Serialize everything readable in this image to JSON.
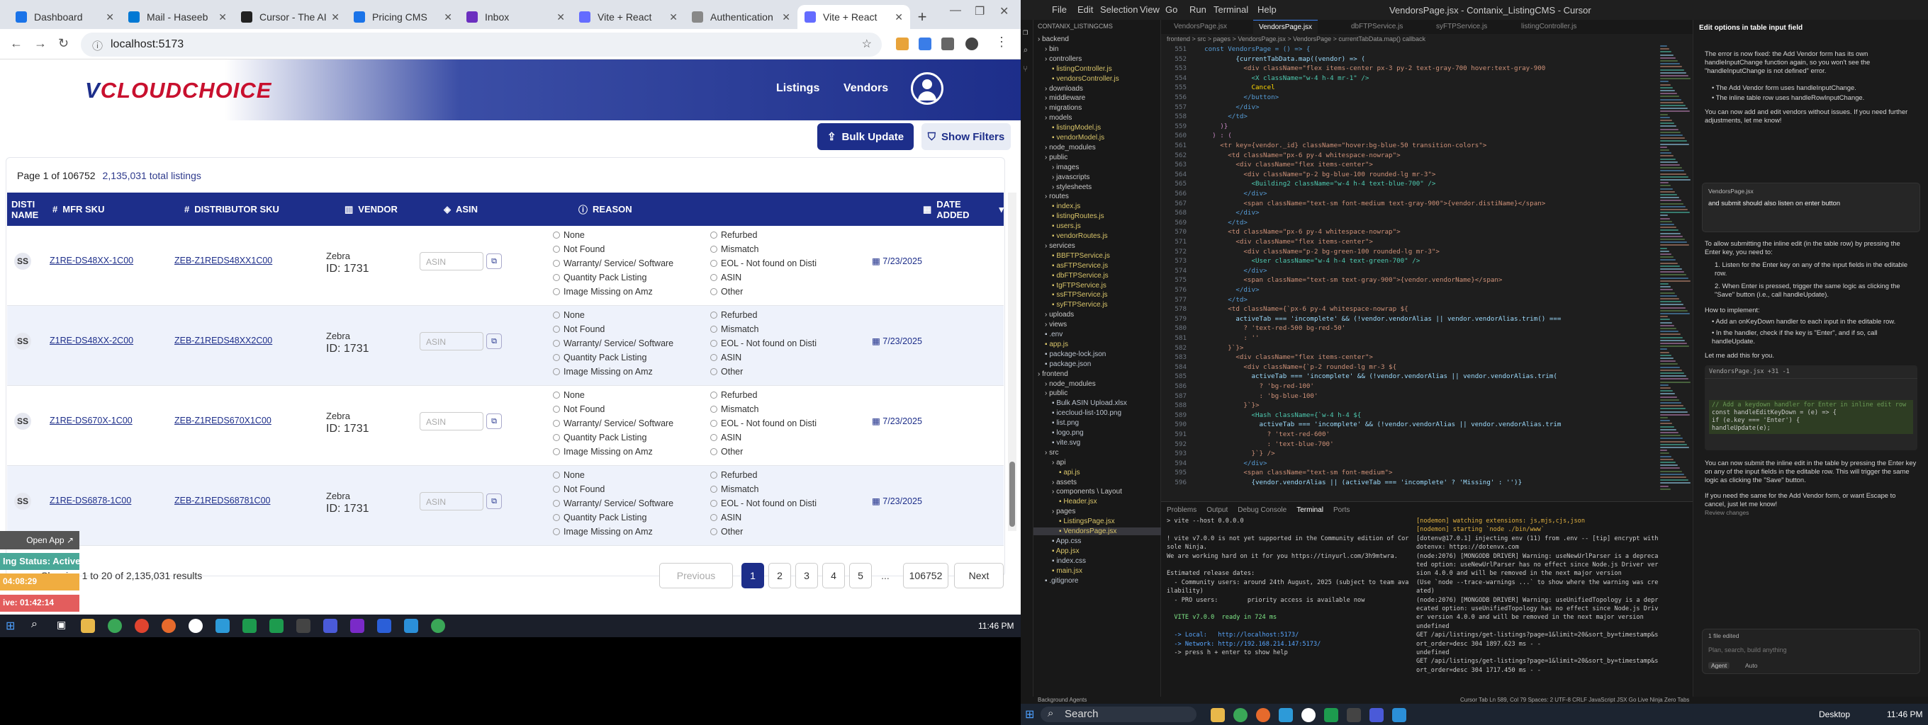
{
  "browser": {
    "tabs": [
      {
        "label": "Dashboard",
        "color": "#1a73e8"
      },
      {
        "label": "Mail - Haseeb",
        "color": "#0078d4"
      },
      {
        "label": "Cursor - The AI",
        "color": "#222"
      },
      {
        "label": "Pricing CMS",
        "color": "#1a73e8"
      },
      {
        "label": "Inbox",
        "color": "#6b2fbf"
      },
      {
        "label": "Vite + React",
        "color": "#646cff"
      },
      {
        "label": "Authentication",
        "color": "#888"
      },
      {
        "label": "Vite + React",
        "color": "#646cff"
      }
    ],
    "url": "localhost:5173"
  },
  "app": {
    "logo": "CLOUDCHOICE",
    "nav": [
      "Listings",
      "Vendors"
    ],
    "bulk_update": "Bulk Update",
    "show_filters": "Show Filters",
    "page_label": "Page 1 of 106752",
    "total_label": "2,135,031 total listings",
    "columns": [
      "DISTI NAME",
      "MFR SKU",
      "DISTRIBUTOR SKU",
      "VENDOR",
      "ASIN",
      "REASON",
      "DATE ADDED"
    ],
    "reasons_left": [
      "None",
      "Not Found",
      "Warranty/ Service/ Software",
      "Quantity Pack Listing",
      "Image Missing on Amz"
    ],
    "reasons_right": [
      "Refurbed",
      "Mismatch",
      "EOL - Not found on Disti",
      "ASIN",
      "Other"
    ],
    "asin_placeholder": "ASIN",
    "rows": [
      {
        "disti": "SS",
        "mfr": "Z1RE-DS48XX-1C00",
        "dsku": "ZEB-Z1REDS48XX1C00",
        "vendor": "Zebra",
        "vid": "ID: 1731",
        "date": "7/23/2025"
      },
      {
        "disti": "SS",
        "mfr": "Z1RE-DS48XX-2C00",
        "dsku": "ZEB-Z1REDS48XX2C00",
        "vendor": "Zebra",
        "vid": "ID: 1731",
        "date": "7/23/2025"
      },
      {
        "disti": "SS",
        "mfr": "Z1RE-DS670X-1C00",
        "dsku": "ZEB-Z1REDS670X1C00",
        "vendor": "Zebra",
        "vid": "ID: 1731",
        "date": "7/23/2025"
      },
      {
        "disti": "SS",
        "mfr": "Z1RE-DS6878-1C00",
        "dsku": "ZEB-Z1REDS68781C00",
        "vendor": "Zebra",
        "vid": "ID: 1731",
        "date": "7/23/2025"
      }
    ],
    "showing": "1 to 20 of 2,135,031 results",
    "pager": [
      "Previous",
      "1",
      "2",
      "3",
      "4",
      "5",
      "...",
      "106752",
      "Next"
    ],
    "open_app": "Open App",
    "status_active": "Ing Status: Active",
    "timer1": "04:08:29",
    "timer2": "ive: 01:42:14",
    "clock": "11:46 PM"
  },
  "ide": {
    "title": "VendorsPage.jsx - Contanix_ListingCMS - Cursor",
    "menu": [
      "File",
      "Edit",
      "Selection",
      "View",
      "Go",
      "Run",
      "Terminal",
      "Help"
    ],
    "tabs": [
      "VendorsPage.jsx",
      "VendorsPage.jsx",
      "dbFTPService.js",
      "syFTPService.js",
      "listingController.js"
    ],
    "breadcrumb": "frontend > src > pages > VendorsPage.jsx > VendorsPage > currentTabData.map() callback",
    "explorer": [
      {
        "t": "backend",
        "c": "fold",
        "i": 0
      },
      {
        "t": "bin",
        "c": "fold",
        "i": 1
      },
      {
        "t": "controllers",
        "c": "fold",
        "i": 1
      },
      {
        "t": "listingController.js",
        "c": "js",
        "i": 2
      },
      {
        "t": "vendorsController.js",
        "c": "js",
        "i": 2
      },
      {
        "t": "downloads",
        "c": "fold",
        "i": 1
      },
      {
        "t": "middleware",
        "c": "fold",
        "i": 1
      },
      {
        "t": "migrations",
        "c": "fold",
        "i": 1
      },
      {
        "t": "models",
        "c": "fold",
        "i": 1
      },
      {
        "t": "listingModel.js",
        "c": "js",
        "i": 2
      },
      {
        "t": "vendorModel.js",
        "c": "js",
        "i": 2
      },
      {
        "t": "node_modules",
        "c": "fold",
        "i": 1
      },
      {
        "t": "public",
        "c": "fold",
        "i": 1
      },
      {
        "t": "images",
        "c": "fold",
        "i": 2
      },
      {
        "t": "javascripts",
        "c": "fold",
        "i": 2
      },
      {
        "t": "stylesheets",
        "c": "fold",
        "i": 2
      },
      {
        "t": "routes",
        "c": "fold",
        "i": 1
      },
      {
        "t": "index.js",
        "c": "js",
        "i": 2
      },
      {
        "t": "listingRoutes.js",
        "c": "js",
        "i": 2
      },
      {
        "t": "users.js",
        "c": "js",
        "i": 2
      },
      {
        "t": "vendorRoutes.js",
        "c": "js",
        "i": 2
      },
      {
        "t": "services",
        "c": "fold",
        "i": 1
      },
      {
        "t": "BBFTPService.js",
        "c": "js",
        "i": 2
      },
      {
        "t": "asFTPService.js",
        "c": "js",
        "i": 2
      },
      {
        "t": "dbFTPService.js",
        "c": "js",
        "i": 2
      },
      {
        "t": "tgFTPService.js",
        "c": "js",
        "i": 2
      },
      {
        "t": "ssFTPService.js",
        "c": "js",
        "i": 2
      },
      {
        "t": "syFTPService.js",
        "c": "js",
        "i": 2
      },
      {
        "t": "uploads",
        "c": "fold",
        "i": 1
      },
      {
        "t": "views",
        "c": "fold",
        "i": 1
      },
      {
        "t": ".env",
        "c": "",
        "i": 1
      },
      {
        "t": "app.js",
        "c": "js",
        "i": 1
      },
      {
        "t": "package-lock.json",
        "c": "",
        "i": 1
      },
      {
        "t": "package.json",
        "c": "",
        "i": 1
      },
      {
        "t": "frontend",
        "c": "fold",
        "i": 0
      },
      {
        "t": "node_modules",
        "c": "fold",
        "i": 1
      },
      {
        "t": "public",
        "c": "fold",
        "i": 1
      },
      {
        "t": "Bulk ASIN Upload.xlsx",
        "c": "",
        "i": 2
      },
      {
        "t": "icecloud-list-100.png",
        "c": "",
        "i": 2
      },
      {
        "t": "list.png",
        "c": "",
        "i": 2
      },
      {
        "t": "logo.png",
        "c": "",
        "i": 2
      },
      {
        "t": "vite.svg",
        "c": "",
        "i": 2
      },
      {
        "t": "src",
        "c": "fold",
        "i": 1
      },
      {
        "t": "api",
        "c": "fold",
        "i": 2
      },
      {
        "t": "api.js",
        "c": "js",
        "i": 3
      },
      {
        "t": "assets",
        "c": "fold",
        "i": 2
      },
      {
        "t": "components \\ Layout",
        "c": "fold",
        "i": 2
      },
      {
        "t": "Header.jsx",
        "c": "js",
        "i": 3
      },
      {
        "t": "pages",
        "c": "fold",
        "i": 2
      },
      {
        "t": "ListingsPage.jsx",
        "c": "js",
        "i": 3
      },
      {
        "t": "VendorsPage.jsx",
        "c": "js sel",
        "i": 3
      },
      {
        "t": "App.css",
        "c": "",
        "i": 2
      },
      {
        "t": "App.jsx",
        "c": "js",
        "i": 2
      },
      {
        "t": "index.css",
        "c": "",
        "i": 2
      },
      {
        "t": "main.jsx",
        "c": "js",
        "i": 2
      },
      {
        "t": ".gitignore",
        "c": "",
        "i": 1
      }
    ],
    "code": [
      [
        "  const VendorsPage = () => {",
        "k"
      ],
      [
        "          {currentTabData.map((vendor) => (",
        "a"
      ],
      [
        "            <div className=\"flex items-center px-3 py-2 text-gray-700 hover:text-gray-900",
        "s"
      ],
      [
        "              <X className=\"w-4 h-4 mr-1\" />",
        "t"
      ],
      [
        "              Cancel",
        "y"
      ],
      [
        "            </button>",
        "k"
      ],
      [
        "          </div>",
        "k"
      ],
      [
        "        </td>",
        "k"
      ],
      [
        "      )}",
        "p"
      ],
      [
        "    ) : (",
        "p"
      ],
      [
        "      <tr key={vendor._id} className=\"hover:bg-blue-50 transition-colors\">",
        "s"
      ],
      [
        "        <td className=\"px-6 py-4 whitespace-nowrap\">",
        "s"
      ],
      [
        "          <div className=\"flex items-center\">",
        "s"
      ],
      [
        "            <div className=\"p-2 bg-blue-100 rounded-lg mr-3\">",
        "s"
      ],
      [
        "              <Building2 className=\"w-4 h-4 text-blue-700\" />",
        "t"
      ],
      [
        "            </div>",
        "k"
      ],
      [
        "            <span className=\"text-sm font-medium text-gray-900\">{vendor.distiName}</span>",
        "s"
      ],
      [
        "          </div>",
        "k"
      ],
      [
        "        </td>",
        "k"
      ],
      [
        "        <td className=\"px-6 py-4 whitespace-nowrap\">",
        "s"
      ],
      [
        "          <div className=\"flex items-center\">",
        "s"
      ],
      [
        "            <div className=\"p-2 bg-green-100 rounded-lg mr-3\">",
        "s"
      ],
      [
        "              <User className=\"w-4 h-4 text-green-700\" />",
        "t"
      ],
      [
        "            </div>",
        "k"
      ],
      [
        "            <span className=\"text-sm text-gray-900\">{vendor.vendorName}</span>",
        "s"
      ],
      [
        "          </div>",
        "k"
      ],
      [
        "        </td>",
        "k"
      ],
      [
        "        <td className={`px-6 py-4 whitespace-nowrap ${",
        "s"
      ],
      [
        "          activeTab === 'incomplete' && (!vendor.vendorAlias || vendor.vendorAlias.trim() ===",
        "a"
      ],
      [
        "            ? 'text-red-500 bg-red-50'",
        "s"
      ],
      [
        "            : ''",
        "s"
      ],
      [
        "        }`}>",
        "s"
      ],
      [
        "          <div className=\"flex items-center\">",
        "s"
      ],
      [
        "            <div className={`p-2 rounded-lg mr-3 ${",
        "s"
      ],
      [
        "              activeTab === 'incomplete' && (!vendor.vendorAlias || vendor.vendorAlias.trim(",
        "a"
      ],
      [
        "                ? 'bg-red-100'",
        "s"
      ],
      [
        "                : 'bg-blue-100'",
        "s"
      ],
      [
        "            }`}>",
        "s"
      ],
      [
        "              <Hash className={`w-4 h-4 ${",
        "t"
      ],
      [
        "                activeTab === 'incomplete' && (!vendor.vendorAlias || vendor.vendorAlias.trim",
        "a"
      ],
      [
        "                  ? 'text-red-600'",
        "s"
      ],
      [
        "                  : 'text-blue-700'",
        "s"
      ],
      [
        "              }`} />",
        "s"
      ],
      [
        "            </div>",
        "k"
      ],
      [
        "            <span className=\"text-sm font-medium\">",
        "s"
      ],
      [
        "              {vendor.vendorAlias || (activeTab === 'incomplete' ? 'Missing' : '')}",
        "a"
      ]
    ],
    "terminal_tabs": [
      "Problems",
      "Output",
      "Debug Console",
      "Terminal",
      "Ports"
    ],
    "term_left": [
      "> vite --host 0.0.0.0",
      "",
      "! vite v7.0.0 is not yet supported in the Community edition of Cor",
      "sole Ninja.",
      "We are working hard on it for you https://tinyurl.com/3h9mtwra.",
      "",
      "Estimated release dates:",
      "  - Community users: around 24th August, 2025 (subject to team ava",
      "ilability)",
      "  - PRO users:        priority access is available now",
      "",
      "  VITE v7.0.0  ready in 724 ms",
      "",
      "  -> Local:   http://localhost:5173/",
      "  -> Network: http://192.168.214.147:5173/",
      "  -> press h + enter to show help"
    ],
    "term_right": [
      "[nodemon] watching extensions: js,mjs,cjs,json",
      "[nodemon] starting `node ./bin/www`",
      "[dotenv@17.0.1] injecting env (11) from .env -- [tip] encrypt with",
      "dotenvx: https://dotenvx.com",
      "(node:2076) [MONGODB DRIVER] Warning: useNewUrlParser is a depreca",
      "ted option: useNewUrlParser has no effect since Node.js Driver ver",
      "sion 4.0.0 and will be removed in the next major version",
      "(Use `node --trace-warnings ...` to show where the warning was cre",
      "ated)",
      "(node:2076) [MONGODB DRIVER] Warning: useUnifiedTopology is a depr",
      "ecated option: useUnifiedTopology has no effect since Node.js Driv",
      "er version 4.0.0 and will be removed in the next major version",
      "undefined",
      "GET /api/listings/get-listings?page=1&limit=20&sort_by=timestamp&s",
      "ort_order=desc 304 1897.623 ms - -",
      "undefined",
      "GET /api/listings/get-listings?page=1&limit=20&sort_by=timestamp&s",
      "ort_order=desc 304 1717.450 ms - -"
    ],
    "chat": {
      "header": "Edit options in table input field",
      "p1": "The error is now fixed: the Add Vendor form has its own handleInputChange function again, so you won't see the \"handleInputChange is not defined\" error.",
      "b1": "The Add Vendor form uses handleInputChange.",
      "b2": "The inline table row uses handleRowInputChange.",
      "p2": "You can now add and edit vendors without issues. If you need further adjustments, let me know!",
      "user_file": "VendorsPage.jsx",
      "user_msg": "and submit should also listen on enter button",
      "p3": "To allow submitting the inline edit (in the table row) by pressing the Enter key, you need to:",
      "n1": "Listen for the Enter key on any of the input fields in the editable row.",
      "n2": "When Enter is pressed, trigger the same logic as clicking the \"Save\" button (i.e., call handleUpdate).",
      "how": "How to implement:",
      "h1": "Add an onKeyDown handler to each input in the editable row.",
      "h2": "In the handler, check if the key is \"Enter\", and if so, call handleUpdate.",
      "p4": "Let me add this for you.",
      "code_file": "VendorsPage.jsx +31 -1",
      "code1": "// Add a keydown handler for Enter in inline edit row",
      "code2": "const handleEditKeyDown = (e) => {",
      "code3": "  if (e.key === 'Enter') {",
      "code4": "    handleUpdate(e);",
      "p5": "You can now submit the inline edit in the table by pressing the Enter key on any of the input fields in the editable row. This will trigger the same logic as clicking the \"Save\" button.",
      "p6": "If you need the same for the Add Vendor form, or want Escape to cancel, just let me know!",
      "review": "Review changes",
      "files_edited": "1 file edited",
      "input_placeholder": "Plan, search, build anything",
      "agent": "Agent",
      "auto": "Auto"
    },
    "status_left": "Background Agents",
    "status_right": "Cursor Tab   Ln 589, Col 79   Spaces: 2   UTF-8   CRLF   JavaScript JSX   Go Live   Ninja   Zero Tabs",
    "search": "Search",
    "desktop": "Desktop",
    "clock": "11:46 PM"
  }
}
